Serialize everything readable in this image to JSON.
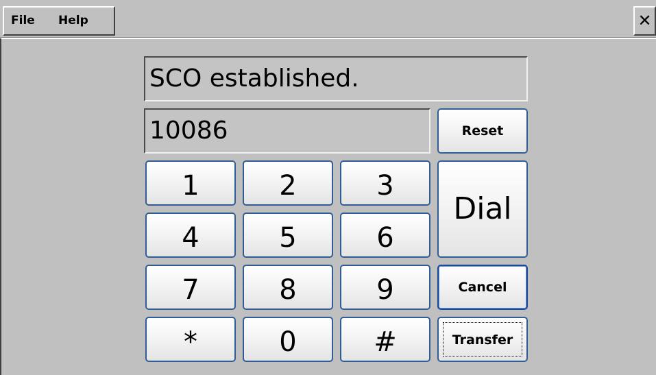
{
  "menubar": {
    "file_label": "File",
    "help_label": "Help",
    "close_glyph": "✕"
  },
  "display": {
    "status_text": "SCO established.",
    "number_value": "10086"
  },
  "buttons": {
    "reset_label": "Reset",
    "dial_label": "Dial",
    "cancel_label": "Cancel",
    "transfer_label": "Transfer"
  },
  "keypad": {
    "keys": [
      "1",
      "2",
      "3",
      "4",
      "5",
      "6",
      "7",
      "8",
      "9",
      "*",
      "0",
      "#"
    ]
  },
  "colors": {
    "window_background": "#c0c0c0",
    "button_border": "#2f5d94",
    "focused_button_border": "#1a4a9a"
  },
  "icons": {
    "close": "close-icon"
  }
}
